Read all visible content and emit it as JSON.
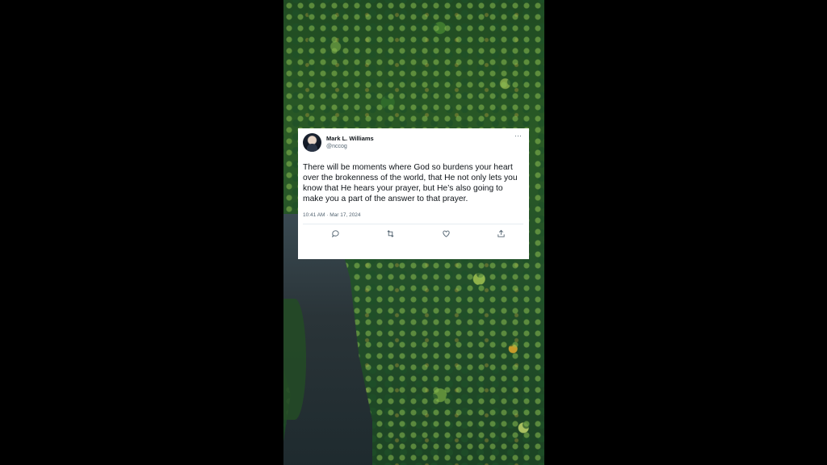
{
  "tweet": {
    "author_name": "Mark L. Williams",
    "author_handle": "@nccog",
    "more_label": "···",
    "text": "There will be moments where God so burdens your heart over the brokenness of the world, that He not only lets you know that He hears your prayer, but He’s also going to make you a part of the answer to that prayer.",
    "timestamp": "10:41 AM · Mar 17, 2024",
    "actions": [
      "reply-icon",
      "retweet-icon",
      "like-icon",
      "share-icon"
    ]
  },
  "colors": {
    "page_background": "#000000",
    "card_background": "#ffffff",
    "text_primary": "#0f1419",
    "text_secondary": "#536471",
    "icon": "#536471"
  }
}
